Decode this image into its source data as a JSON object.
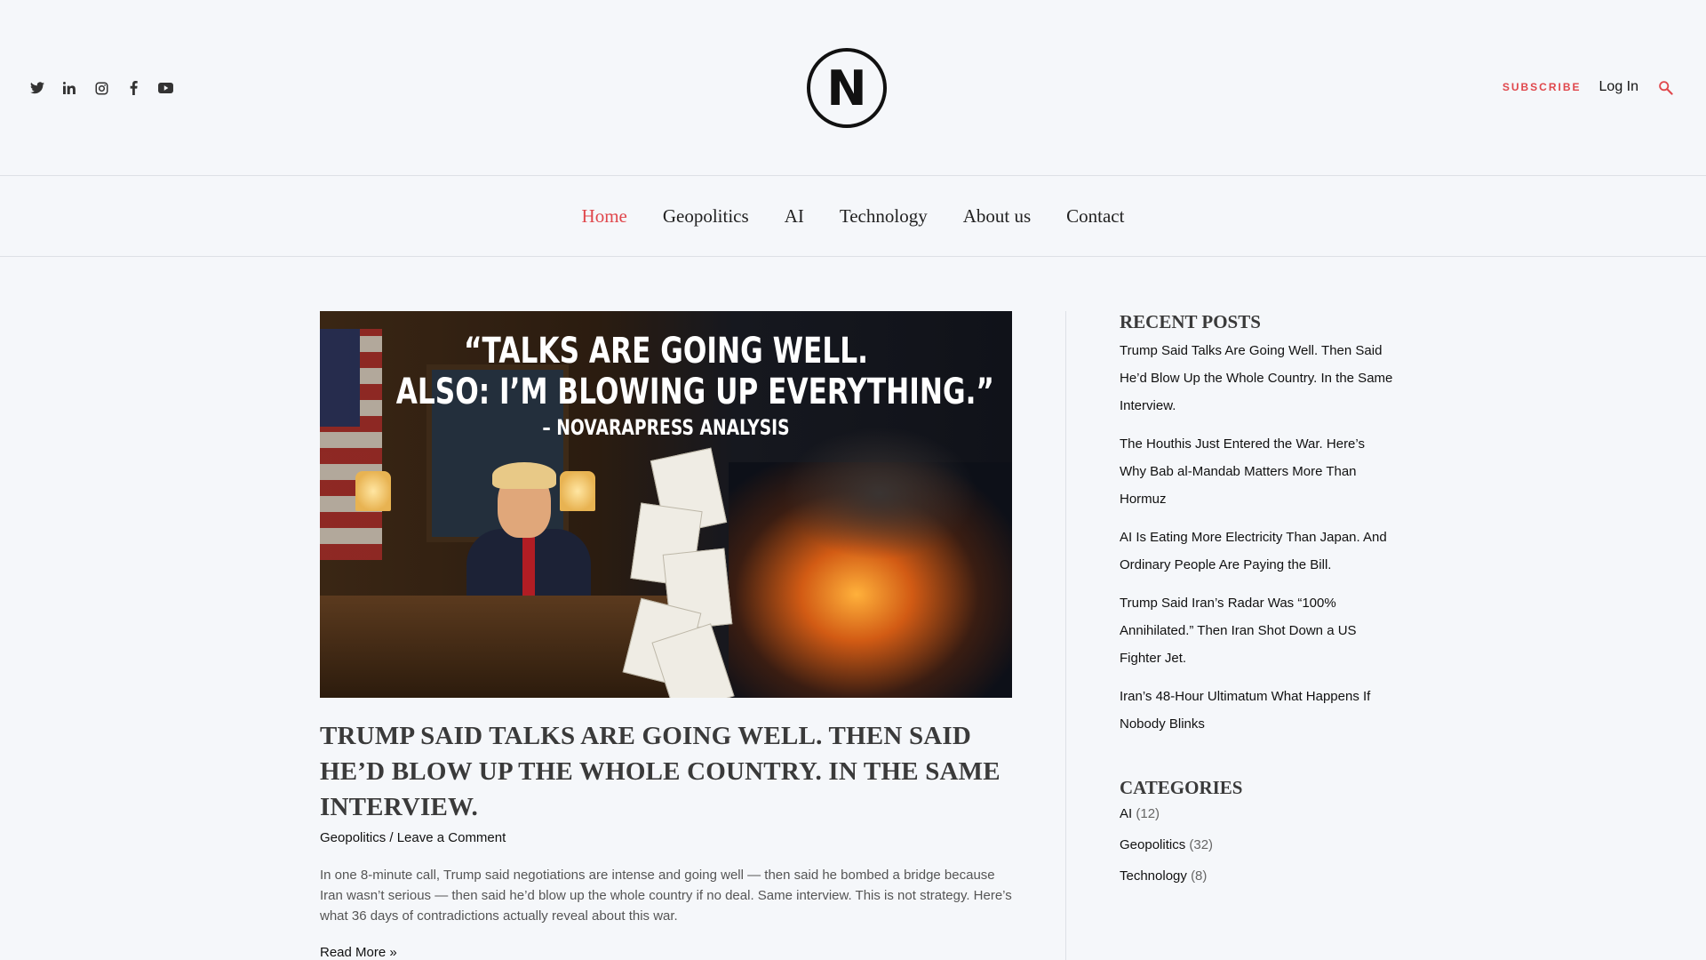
{
  "header": {
    "social": [
      {
        "name": "twitter-icon"
      },
      {
        "name": "linkedin-icon"
      },
      {
        "name": "instagram-icon"
      },
      {
        "name": "facebook-icon"
      },
      {
        "name": "youtube-icon"
      }
    ],
    "logo_letter": "N",
    "subscribe_label": "SUBSCRIBE",
    "login_label": "Log In",
    "accent_color": "#e0474c"
  },
  "nav": {
    "items": [
      {
        "label": "Home",
        "active": true
      },
      {
        "label": "Geopolitics"
      },
      {
        "label": "AI"
      },
      {
        "label": "Technology"
      },
      {
        "label": "About us"
      },
      {
        "label": "Contact"
      }
    ]
  },
  "post": {
    "image_headline_1": "“TALKS ARE GOING WELL.",
    "image_headline_2": "ALSO: I’M BLOWING UP EVERYTHING.”",
    "image_headline_3": "– NOVARAPRESS ANALYSIS",
    "title": "Trump Said Talks Are Going Well. Then Said He’d Blow Up the Whole Country. In the Same Interview.",
    "category": "Geopolitics",
    "separator": " / ",
    "comment_link": "Leave a Comment",
    "excerpt": "In one 8-minute call, Trump said negotiations are intense and going well — then said he bombed a bridge because Iran wasn’t serious — then said he’d blow up the whole country if no deal. Same interview. This is not strategy. Here’s what 36 days of contradictions actually reveal about this war.",
    "read_more": "Read More »"
  },
  "sidebar": {
    "recent_title": "RECENT POSTS",
    "recent_posts": [
      "Trump Said Talks Are Going Well. Then Said He’d Blow Up the Whole Country. In the Same Interview.",
      "The Houthis Just Entered the War. Here’s Why Bab al-Mandab Matters More Than Hormuz",
      "AI Is Eating More Electricity Than Japan. And Ordinary People Are Paying the Bill.",
      "Trump Said Iran’s Radar Was “100% Annihilated.” Then Iran Shot Down a US Fighter Jet.",
      "Iran’s 48-Hour Ultimatum What Happens If Nobody Blinks"
    ],
    "categories_title": "CATEGORIES",
    "categories": [
      {
        "name": "AI",
        "count": "(12)"
      },
      {
        "name": "Geopolitics",
        "count": "(32)"
      },
      {
        "name": "Technology",
        "count": "(8)"
      }
    ]
  }
}
